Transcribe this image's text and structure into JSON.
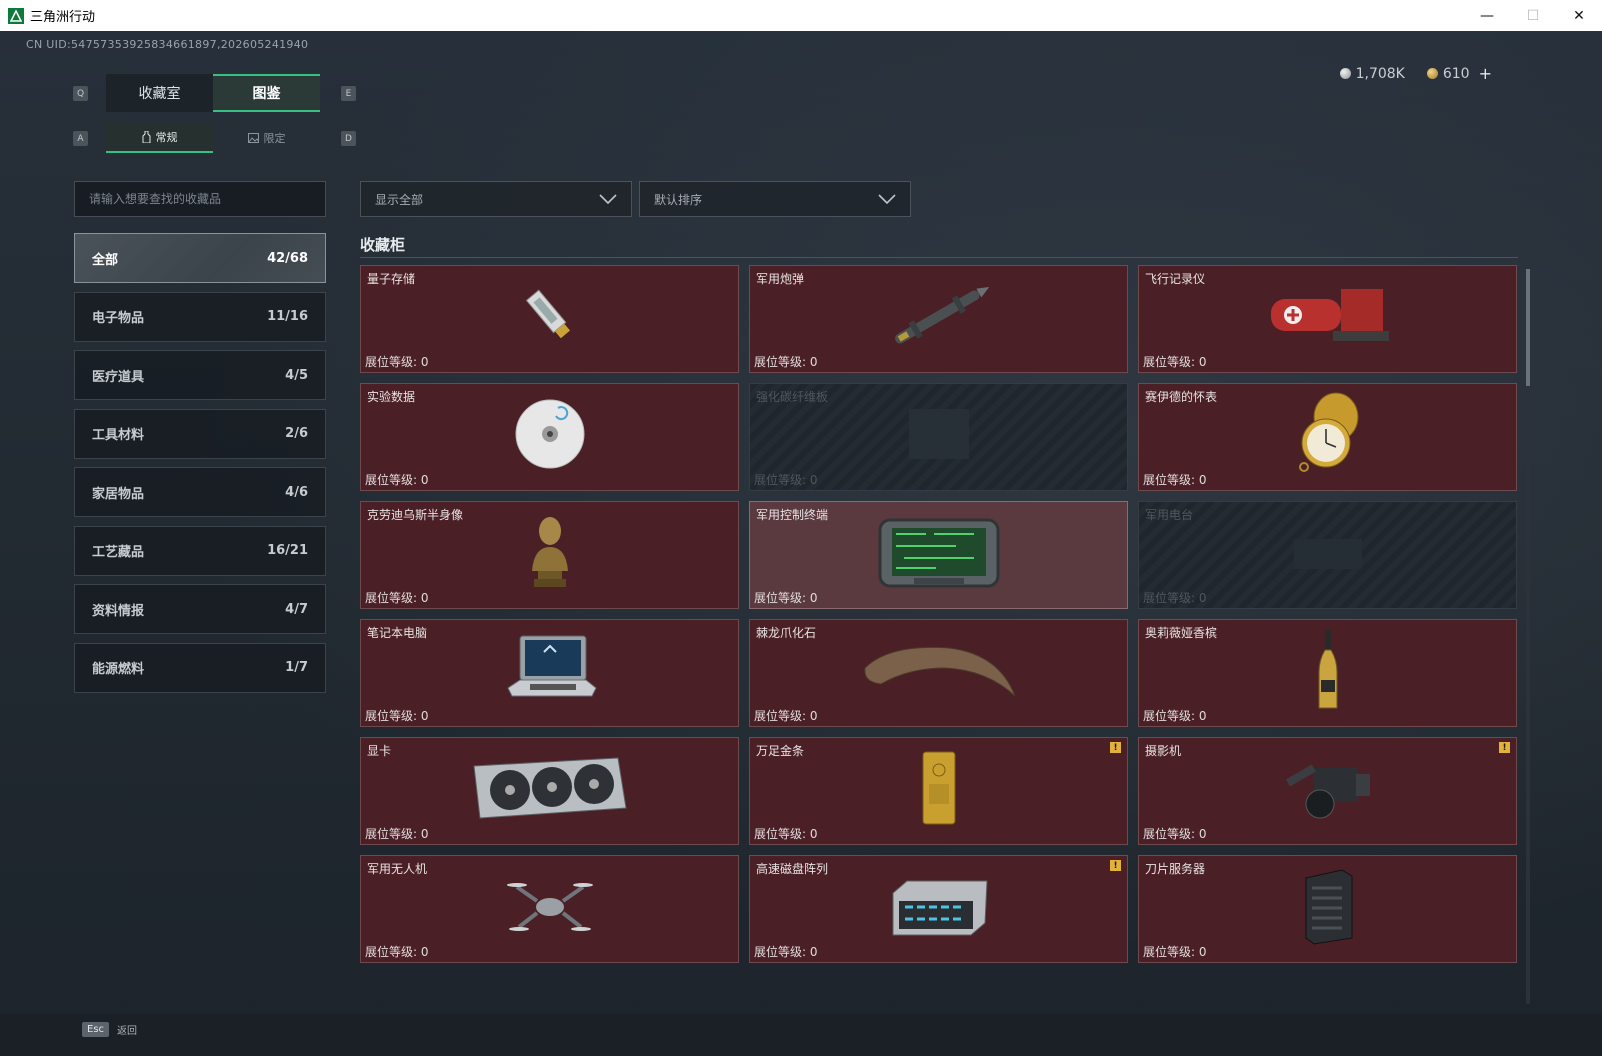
{
  "window": {
    "title": "三角洲行动",
    "minimize": "—",
    "maximize": "☐",
    "close": "✕"
  },
  "uid": "CN UID:54757353925834661897,202605241940",
  "currency": {
    "silver": "1,708K",
    "gold": "610",
    "add": "+"
  },
  "keyhints": {
    "prev_tab": "Q",
    "next_tab": "E",
    "prev_sub": "A",
    "next_sub": "D"
  },
  "tabs": [
    {
      "label": "收藏室",
      "active": false
    },
    {
      "label": "图鉴",
      "active": true
    }
  ],
  "subtabs": [
    {
      "label": "常规",
      "active": true
    },
    {
      "label": "限定",
      "active": false
    }
  ],
  "search": {
    "placeholder": "请输入想要查找的收藏品"
  },
  "filters": {
    "display": "显示全部",
    "sort": "默认排序"
  },
  "categories": [
    {
      "label": "全部",
      "count": "42/68",
      "active": true
    },
    {
      "label": "电子物品",
      "count": "11/16"
    },
    {
      "label": "医疗道具",
      "count": "4/5"
    },
    {
      "label": "工具材料",
      "count": "2/6"
    },
    {
      "label": "家居物品",
      "count": "4/6"
    },
    {
      "label": "工艺藏品",
      "count": "16/21"
    },
    {
      "label": "资料情报",
      "count": "4/7"
    },
    {
      "label": "能源燃料",
      "count": "1/7"
    }
  ],
  "section_title": "收藏柜",
  "level_label": "展位等级: 0",
  "items": [
    {
      "name": "量子存储",
      "icon": "usb-drive-icon"
    },
    {
      "name": "军用炮弹",
      "icon": "missile-icon"
    },
    {
      "name": "飞行记录仪",
      "icon": "flight-recorder-icon"
    },
    {
      "name": "实验数据",
      "icon": "disc-icon"
    },
    {
      "name": "强化碳纤维板",
      "icon": "carbon-plate-icon",
      "locked": true
    },
    {
      "name": "赛伊德的怀表",
      "icon": "pocket-watch-icon"
    },
    {
      "name": "克劳迪乌斯半身像",
      "icon": "bust-icon"
    },
    {
      "name": "军用控制终端",
      "icon": "control-terminal-icon",
      "featured": true
    },
    {
      "name": "军用电台",
      "icon": "radio-icon",
      "locked": true
    },
    {
      "name": "笔记本电脑",
      "icon": "laptop-icon"
    },
    {
      "name": "棘龙爪化石",
      "icon": "claw-fossil-icon"
    },
    {
      "name": "奥莉薇娅香槟",
      "icon": "champagne-icon"
    },
    {
      "name": "显卡",
      "icon": "gpu-icon"
    },
    {
      "name": "万足金条",
      "icon": "gold-bar-icon",
      "badge": "!"
    },
    {
      "name": "摄影机",
      "icon": "camera-icon",
      "badge": "!"
    },
    {
      "name": "军用无人机",
      "icon": "drone-icon"
    },
    {
      "name": "高速磁盘阵列",
      "icon": "disk-array-icon",
      "badge": "!"
    },
    {
      "name": "刀片服务器",
      "icon": "blade-server-icon"
    }
  ],
  "bottom": {
    "esc_key": "Esc",
    "back": "返回"
  },
  "colors": {
    "accent": "#35c184",
    "card_bg": "#4a2026",
    "badge": "#e3b23c"
  }
}
